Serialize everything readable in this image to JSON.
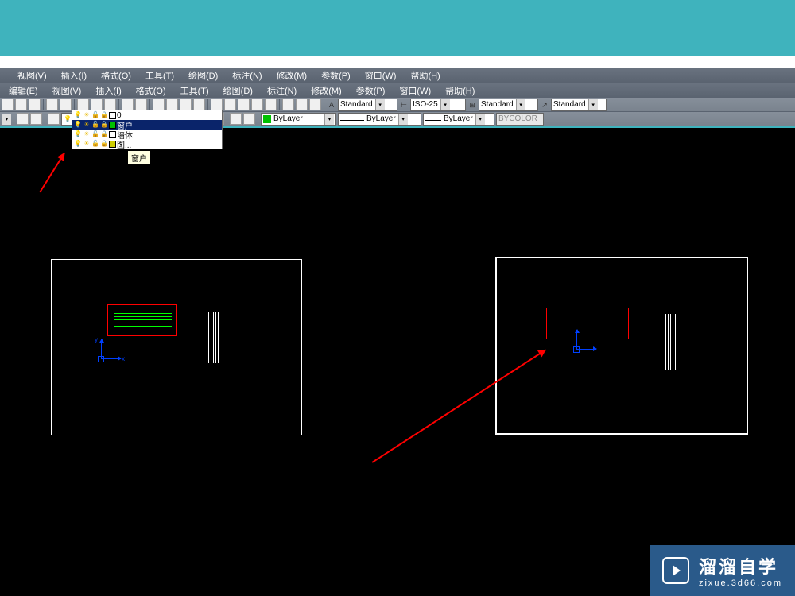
{
  "menus": {
    "row1": [
      "",
      "视图(V)",
      "插入(I)",
      "格式(O)",
      "工具(T)",
      "绘图(D)",
      "标注(N)",
      "修改(M)",
      "参数(P)",
      "窗口(W)",
      "帮助(H)"
    ],
    "row2": [
      "编辑(E)",
      "视图(V)",
      "插入(I)",
      "格式(O)",
      "工具(T)",
      "绘图(D)",
      "标注(N)",
      "修改(M)",
      "参数(P)",
      "窗口(W)",
      "帮助(H)"
    ]
  },
  "styles": {
    "text_style": "Standard",
    "dim_style": "ISO-25",
    "table_style": "Standard",
    "mleader_style": "Standard"
  },
  "layer_combo": "窗户",
  "properties": {
    "layer": "ByLayer",
    "linetype": "ByLayer",
    "lineweight": "ByLayer",
    "color": "BYCOLOR"
  },
  "layer_list": [
    {
      "name": "0",
      "color": "#ffffff",
      "selected": false
    },
    {
      "name": "窗户",
      "color": "#00ff00",
      "selected": true
    },
    {
      "name": "墙体",
      "color": "#ffffff",
      "selected": false
    },
    {
      "name": "图...",
      "color": "#ffff00",
      "selected": false
    }
  ],
  "tooltip": "窗户",
  "watermark": {
    "title": "溜溜自学",
    "url": "zixue.3d66.com"
  },
  "icons": {
    "bulb": "💡",
    "sun": "☀",
    "lock": "🔒",
    "print": "🖨"
  }
}
